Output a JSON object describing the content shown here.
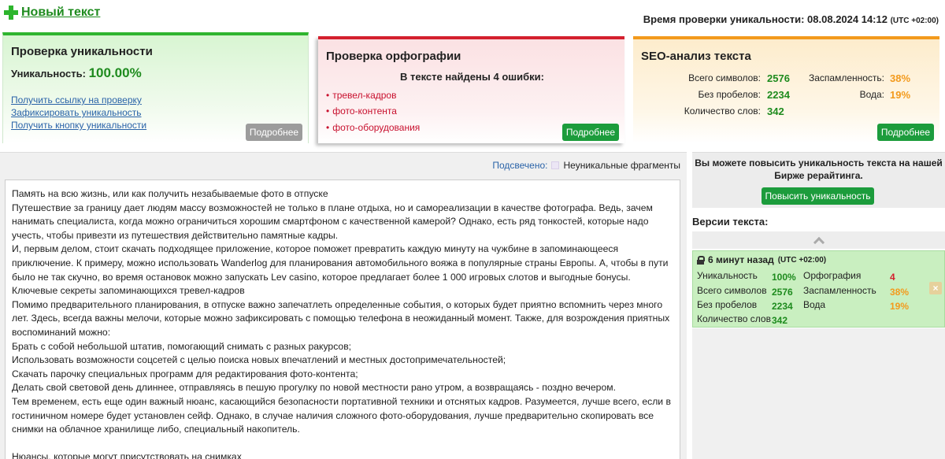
{
  "header": {
    "new_text_label": "Новый текст",
    "check_time_label": "Время проверки уникальности: 08.08.2024 14:12",
    "check_time_tz": "(UTC +02:00)"
  },
  "uniqueness_card": {
    "title": "Проверка уникальности",
    "uniqueness_label": "Уникальность:",
    "uniqueness_value": "100.00%",
    "links": [
      "Получить ссылку на проверку",
      "Зафиксировать уникальность",
      "Получить кнопку уникальности"
    ],
    "more_label": "Подробнее"
  },
  "spelling_card": {
    "title": "Проверка орфографии",
    "summary": "В тексте найдены 4 ошибки:",
    "errors": [
      "тревел-кадров",
      "фото-контента",
      "фото-оборудования"
    ],
    "more_label": "Подробнее"
  },
  "seo_card": {
    "title": "SEO-анализ текста",
    "total_chars_label": "Всего символов:",
    "total_chars_value": "2576",
    "no_spaces_label": "Без пробелов:",
    "no_spaces_value": "2234",
    "words_label": "Количество слов:",
    "words_value": "342",
    "spam_label": "Заспамленность:",
    "spam_value": "38%",
    "water_label": "Вода:",
    "water_value": "19%",
    "more_label": "Подробнее"
  },
  "legend": {
    "highlighted_label": "Подсвечено:",
    "non_unique_label": "Неуникальные фрагменты"
  },
  "text_lines": [
    "Память на всю жизнь, или как получить незабываемые фото в отпуске",
    "Путешествие за границу дает людям массу возможностей не только в плане отдыха, но и самореализации в качестве фотографа. Ведь, зачем нанимать специалиста, когда можно ограничиться хорошим смартфоном с качественной камерой? Однако, есть ряд тонкостей, которые надо учесть, чтобы привезти из путешествия действительно памятные кадры.",
    "И, первым делом, стоит скачать подходящее приложение, которое поможет превратить каждую минуту на чужбине в запоминающееся приключение. К примеру, можно использовать Wanderlog для планирования автомобильного вояжа в популярные страны Европы. А, чтобы в пути было не так скучно, во время остановок можно запускать Lev casino, которое предлагает более 1 000 игровых слотов и выгодные бонусы.",
    "Ключевые секреты запоминающихся тревел-кадров",
    "Помимо предварительного планирования, в отпуске важно запечатлеть определенные события, о которых будет приятно вспомнить через много лет. Здесь, всегда важны мелочи, которые можно зафиксировать с помощью телефона в неожиданный момент. Также, для возрождения приятных воспоминаний можно:",
    "Брать с собой небольшой штатив, помогающий снимать с разных ракурсов;",
    "Использовать возможности соцсетей с целью поиска новых впечатлений и местных достопримечательностей;",
    "Скачать парочку специальных программ для редактирования фото-контента;",
    "Делать свой световой день длиннее, отправляясь в пешую прогулку по новой местности рано утром, а возвращаясь - поздно вечером.",
    "Тем временем, есть еще один важный нюанс, касающийся безопасности портативной техники и отснятых кадров. Разумеется, лучше всего, если в гостиничном номере будет установлен сейф. Однако, в случае наличия сложного фото-оборудования, лучше предварительно скопировать все снимки на облачное хранилище либо, специальный накопитель.",
    "",
    "Нюансы, которые могут присутствовать на снимках"
  ],
  "promo": {
    "text": "Вы можете повысить уникальность текста на нашей Бирже рерайтинга.",
    "button_label": "Повысить уникальность"
  },
  "versions": {
    "title": "Версии текста:",
    "item": {
      "time": "6 минут назад",
      "tz": "(UTC +02:00)",
      "uniqueness_label": "Уникальность",
      "uniqueness_value": "100%",
      "total_chars_label": "Всего символов",
      "total_chars_value": "2576",
      "no_spaces_label": "Без пробелов",
      "no_spaces_value": "2234",
      "words_label": "Количество слов",
      "words_value": "342",
      "spelling_label": "Орфография",
      "spelling_value": "4",
      "spam_label": "Заспамленность",
      "spam_value": "38%",
      "water_label": "Вода",
      "water_value": "19%",
      "close_glyph": "×"
    }
  },
  "colors": {
    "green": "#1e8b1e",
    "red": "#d4202e",
    "orange": "#f39a1c",
    "button_green": "#1c9c3c",
    "link_blue": "#2a63a8"
  }
}
